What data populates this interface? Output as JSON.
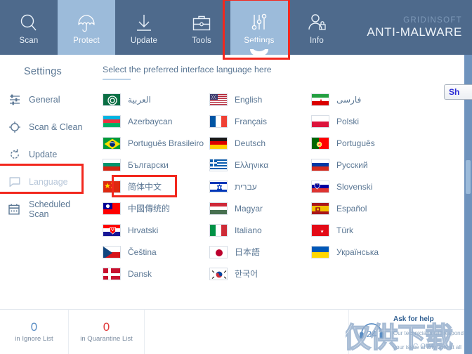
{
  "topnav": {
    "tabs": [
      {
        "label": "Scan",
        "icon": "magnifier-icon",
        "active": false
      },
      {
        "label": "Protect",
        "icon": "umbrella-icon",
        "active": true
      },
      {
        "label": "Update",
        "icon": "download-icon",
        "active": false
      },
      {
        "label": "Tools",
        "icon": "briefcase-icon",
        "active": false
      },
      {
        "label": "Settings",
        "icon": "sliders-icon",
        "active": true
      },
      {
        "label": "Info",
        "icon": "user-lock-icon",
        "active": false
      }
    ],
    "brand_top": "GRIDINSOFT",
    "brand_main": "ANTI-MALWARE",
    "bg_color": "#4e6a8c",
    "active_color": "#9cbbda"
  },
  "sidebar": {
    "title": "Settings",
    "items": [
      {
        "label": "General",
        "icon": "sliders-icon"
      },
      {
        "label": "Scan & Clean",
        "icon": "crosshair-icon"
      },
      {
        "label": "Update",
        "icon": "refresh-icon"
      },
      {
        "label": "Language",
        "icon": "speech-bubble-icon"
      },
      {
        "label": "Scheduled Scan",
        "icon": "calendar-icon"
      }
    ]
  },
  "main": {
    "heading": "Select the preferred interface language here",
    "columns": [
      [
        {
          "name": "العربية",
          "flag": "sa",
          "rtl": true
        },
        {
          "name": "Azerbaycan",
          "flag": "az",
          "rtl": false
        },
        {
          "name": "Português Brasileiro",
          "flag": "br",
          "rtl": false
        },
        {
          "name": "Български",
          "flag": "bg",
          "rtl": false
        },
        {
          "name": "简体中文",
          "flag": "cn",
          "rtl": false
        },
        {
          "name": "中國傳统的",
          "flag": "tw",
          "rtl": false
        },
        {
          "name": "Hrvatski",
          "flag": "hr",
          "rtl": false
        },
        {
          "name": "Čeština",
          "flag": "cz",
          "rtl": false
        },
        {
          "name": "Dansk",
          "flag": "dk",
          "rtl": false
        }
      ],
      [
        {
          "name": "English",
          "flag": "us",
          "rtl": false
        },
        {
          "name": "Français",
          "flag": "fr",
          "rtl": false
        },
        {
          "name": "Deutsch",
          "flag": "de",
          "rtl": false
        },
        {
          "name": "Ελληνικα",
          "flag": "gr",
          "rtl": false
        },
        {
          "name": "עברית",
          "flag": "il",
          "rtl": true
        },
        {
          "name": "Magyar",
          "flag": "hu",
          "rtl": false
        },
        {
          "name": "Italiano",
          "flag": "it",
          "rtl": false
        },
        {
          "name": "日本語",
          "flag": "jp",
          "rtl": false
        },
        {
          "name": "한국어",
          "flag": "kr",
          "rtl": false
        }
      ],
      [
        {
          "name": "فارسی",
          "flag": "ir",
          "rtl": true
        },
        {
          "name": "Polski",
          "flag": "pl",
          "rtl": false
        },
        {
          "name": "Português",
          "flag": "pt",
          "rtl": false
        },
        {
          "name": "Русский",
          "flag": "ru",
          "rtl": false
        },
        {
          "name": "Slovenski",
          "flag": "si",
          "rtl": false
        },
        {
          "name": "Español",
          "flag": "es",
          "rtl": false
        },
        {
          "name": "Türk",
          "flag": "tr",
          "rtl": false
        },
        {
          "name": "Українська",
          "flag": "ua",
          "rtl": false
        }
      ]
    ]
  },
  "bottombar": {
    "ignore": {
      "count": "0",
      "caption": "in Ignore List"
    },
    "quarantine": {
      "count": "0",
      "caption": "in Quarantine List"
    },
    "help": {
      "badge": "24",
      "title": "Ask for help",
      "subtitle": "Our technicians will respond to your issue at any time at all"
    }
  },
  "overlay": {
    "cut_button_label": "Sh",
    "watermark_main": "仅供下载",
    "watermark_sub": "COM"
  },
  "annotations": {
    "settings_box": "#f2281e",
    "language_box": "#f2281e",
    "chinese_box": "#f2281e"
  }
}
